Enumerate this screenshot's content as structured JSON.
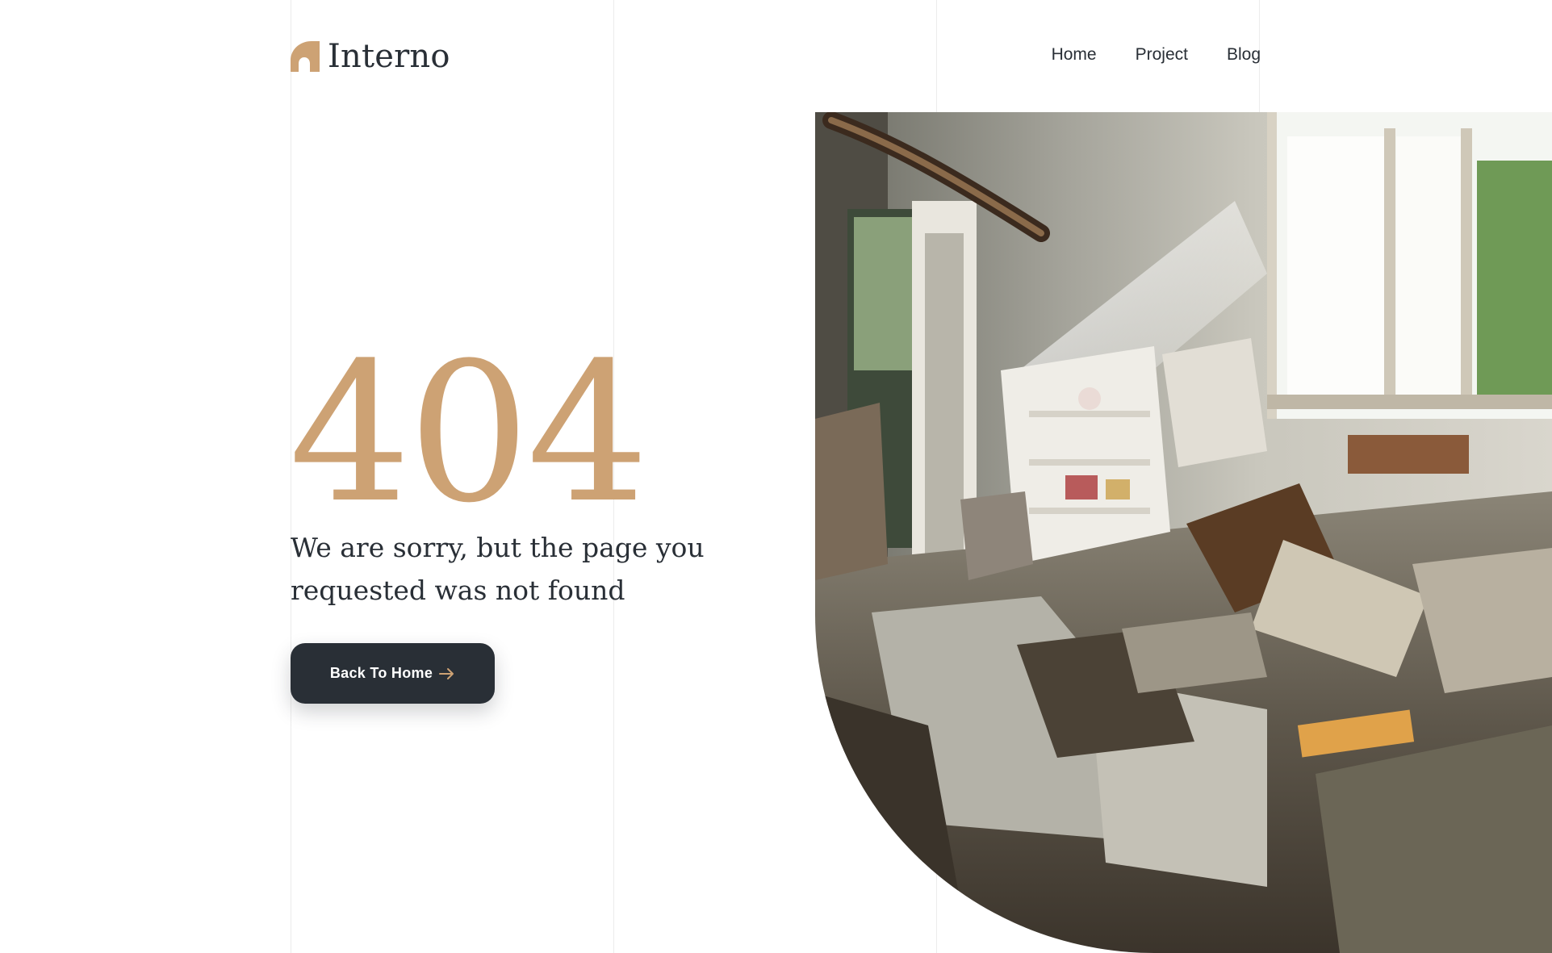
{
  "brand": {
    "name": "Interno",
    "accent_color": "#cda274",
    "dark_color": "#292f36"
  },
  "nav": {
    "items": [
      {
        "label": "Home"
      },
      {
        "label": "Project"
      },
      {
        "label": "Blog"
      }
    ]
  },
  "hero": {
    "code": "404",
    "message": "We are sorry, but the page  you requested was not found",
    "button_label": "Back To Home",
    "button_icon": "arrow-right-icon"
  },
  "photo": {
    "icon": "abandoned-room-photo"
  }
}
